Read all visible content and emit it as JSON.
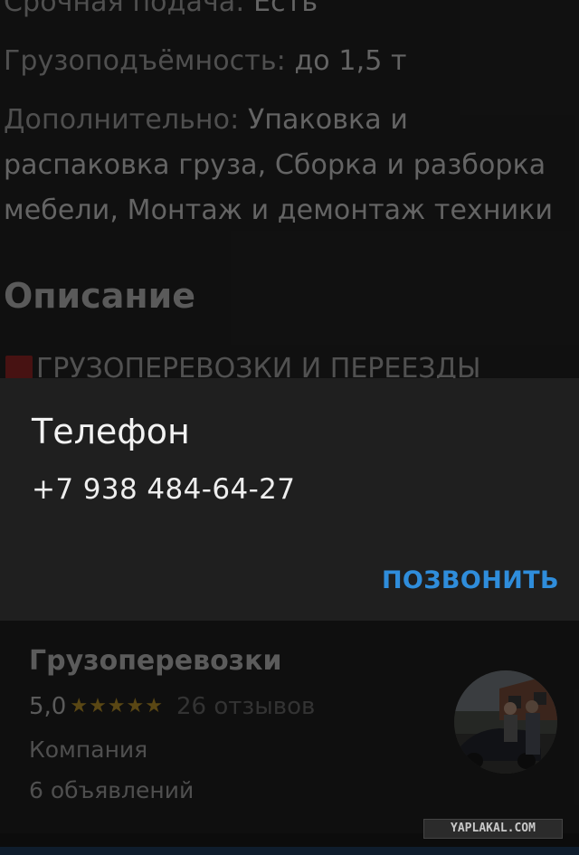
{
  "details": {
    "urgent_label": "Срочная подача:",
    "urgent_value": "Есть",
    "capacity_label": "Грузоподъёмность:",
    "capacity_value": "до 1,5 т",
    "extra_label": "Дополнительно:",
    "extra_value": "Упаковка и распаковка груза, Сборка и разборка мебели, Монтаж и демонтаж техники"
  },
  "description": {
    "heading": "Описание",
    "first_line": "ГРУЗОПЕРЕВОЗКИ И ПЕРЕЕЗДЫ"
  },
  "dialog": {
    "title": "Телефон",
    "phone": "+7 938 484-64-27",
    "call_label": "ПОЗВОНИТЬ",
    "accent_color": "#2f8ddb"
  },
  "seller": {
    "name": "Грузоперевозки",
    "rating": "5,0",
    "stars": "★★★★★",
    "star_count": 5,
    "reviews": "26 отзывов",
    "type": "Компания",
    "ads_count": "6 объявлений"
  },
  "watermark": "YAPLAKAL.COM"
}
